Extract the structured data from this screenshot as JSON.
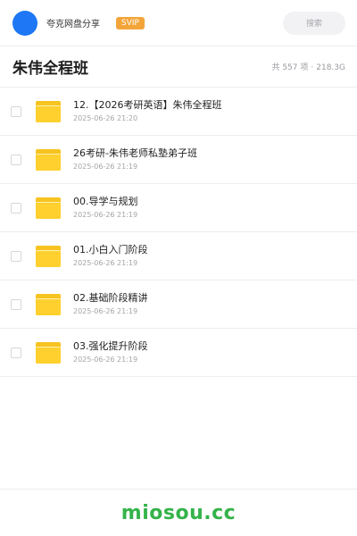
{
  "header": {
    "username": "夸克网盘分享",
    "vip_badge": "SVIP",
    "search_label": "搜索",
    "colors": {
      "avatar": "#1e77f5",
      "vip": "#f3a539"
    }
  },
  "title_bar": {
    "title": "朱伟全程班",
    "item_count": "共 557 项",
    "separator": "·",
    "total_size": "218.3G"
  },
  "files": [
    {
      "name": "12.【2026考研英语】朱伟全程班",
      "date": "2025-06-26 21:20",
      "icon": "folder-icon"
    },
    {
      "name": "26考研-朱伟老师私塾弟子班",
      "date": "2025-06-26 21:19",
      "icon": "folder-icon"
    },
    {
      "name": "00.导学与规划",
      "date": "2025-06-26 21:19",
      "icon": "folder-icon"
    },
    {
      "name": "01.小白入门阶段",
      "date": "2025-06-26 21:19",
      "icon": "folder-icon"
    },
    {
      "name": "02.基础阶段精讲",
      "date": "2025-06-26 21:19",
      "icon": "folder-icon"
    },
    {
      "name": "03.强化提升阶段",
      "date": "2025-06-26 21:19",
      "icon": "folder-icon"
    }
  ],
  "footer": {
    "watermark": "miosou.cc",
    "color": "#34b34a"
  }
}
